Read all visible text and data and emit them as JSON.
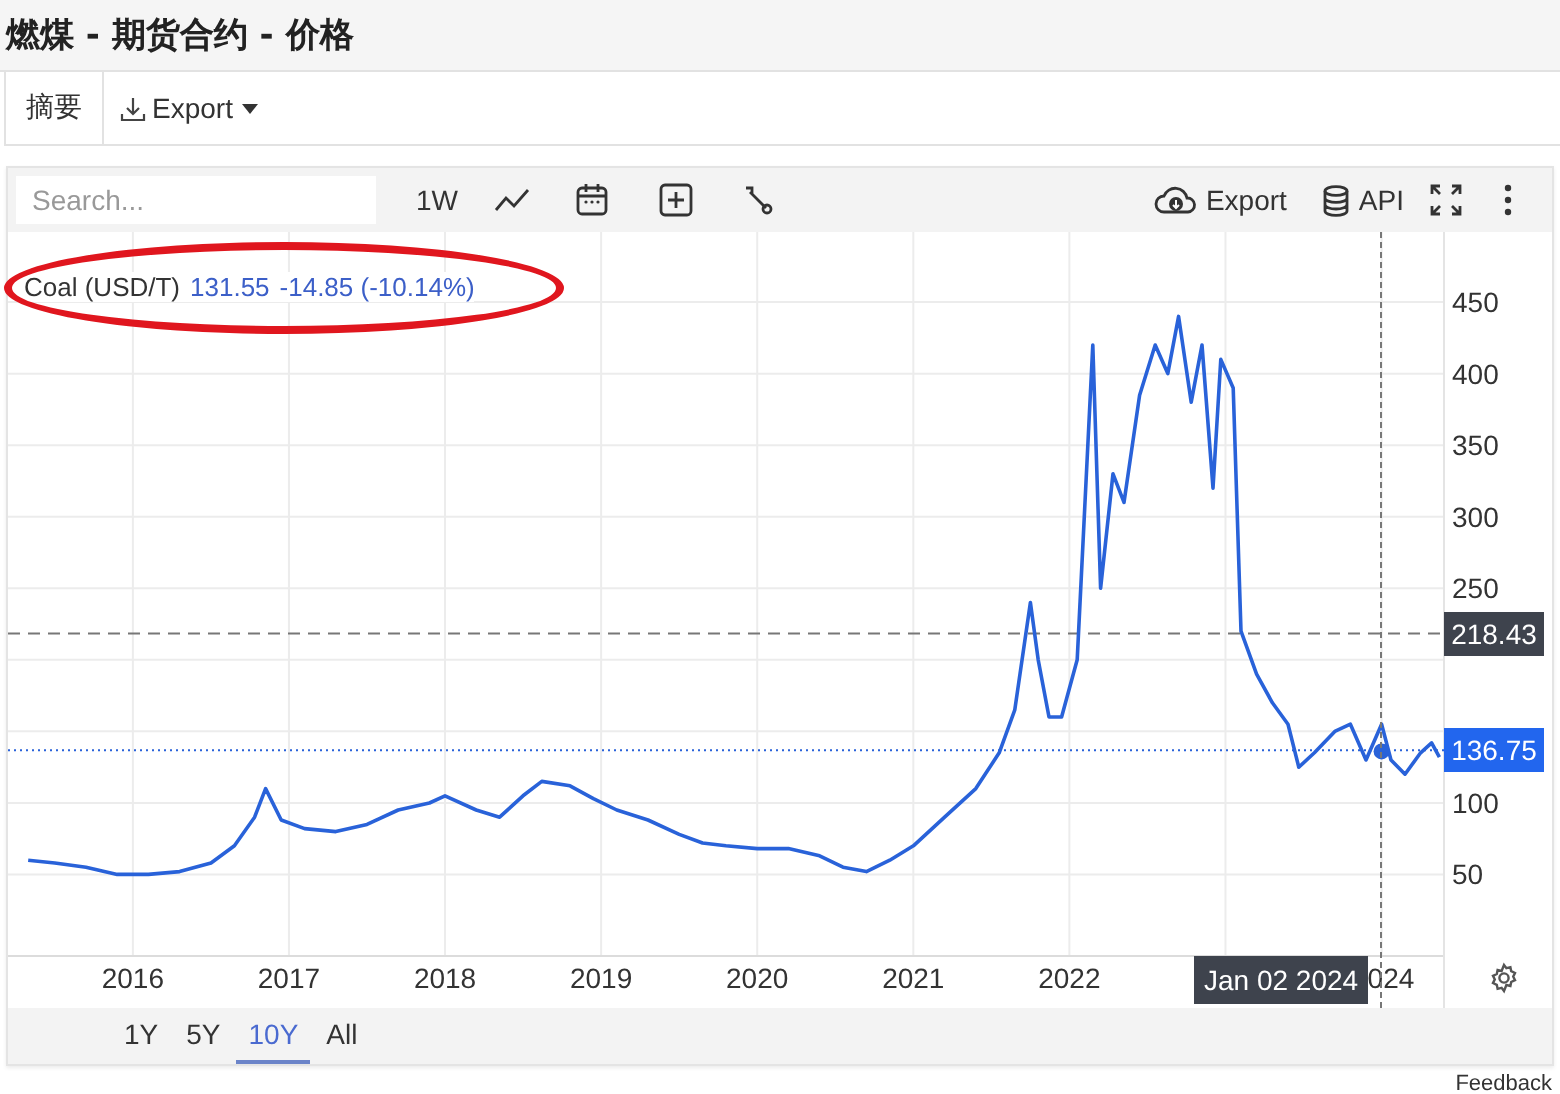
{
  "page_title": "燃煤 - 期货合约 - 价格",
  "tabs": [
    {
      "label": "摘要",
      "selected": true
    }
  ],
  "export_menu": {
    "label": "Export"
  },
  "toolbar": {
    "search": {
      "placeholder": "Search..."
    },
    "interval": "1W",
    "export": "Export",
    "api": "API"
  },
  "legend": {
    "price": "131.55",
    "change": "-14.85 (-10.14%)"
  },
  "chart": {
    "axis_fragment": "024",
    "chart_data": {
      "type": "line",
      "xlim": [
        2015.2,
        2024.4
      ],
      "ylim": [
        -7,
        499
      ],
      "grid": true,
      "xticks": [
        2016,
        2017,
        2018,
        2019,
        2020,
        2021,
        2022
      ],
      "yticks": [
        50,
        100,
        250,
        300,
        350,
        400,
        450
      ],
      "ref_lines": [
        {
          "axis": "y",
          "value": 136.75
        },
        {
          "axis": "y",
          "value": 218.43
        }
      ],
      "series": [
        {
          "name": "Coal (USD/T)",
          "color": "#2962d9",
          "x": [
            2015.33,
            2015.5,
            2015.7,
            2015.9,
            2016.1,
            2016.3,
            2016.5,
            2016.65,
            2016.78,
            2016.85,
            2016.95,
            2017.1,
            2017.3,
            2017.5,
            2017.7,
            2017.9,
            2018.0,
            2018.2,
            2018.35,
            2018.5,
            2018.62,
            2018.8,
            2018.95,
            2019.1,
            2019.3,
            2019.5,
            2019.65,
            2019.8,
            2020.0,
            2020.2,
            2020.4,
            2020.55,
            2020.7,
            2020.85,
            2021.0,
            2021.2,
            2021.4,
            2021.55,
            2021.65,
            2021.75,
            2021.8,
            2021.87,
            2021.95,
            2022.05,
            2022.15,
            2022.2,
            2022.28,
            2022.35,
            2022.45,
            2022.55,
            2022.63,
            2022.7,
            2022.78,
            2022.85,
            2022.92,
            2022.97,
            2023.05,
            2023.1,
            2023.2,
            2023.3,
            2023.4,
            2023.47,
            2023.57,
            2023.7,
            2023.8,
            2023.9,
            2024.0,
            2024.06,
            2024.15,
            2024.25,
            2024.32,
            2024.37
          ],
          "values": [
            60,
            58,
            55,
            50,
            50,
            52,
            58,
            70,
            90,
            110,
            88,
            82,
            80,
            85,
            95,
            100,
            105,
            95,
            90,
            105,
            115,
            112,
            103,
            95,
            88,
            78,
            72,
            70,
            68,
            68,
            63,
            55,
            52,
            60,
            70,
            90,
            110,
            135,
            165,
            240,
            200,
            160,
            160,
            200,
            420,
            250,
            330,
            310,
            385,
            420,
            400,
            440,
            380,
            420,
            320,
            410,
            390,
            220,
            190,
            170,
            155,
            125,
            135,
            150,
            155,
            130,
            155,
            130,
            120,
            135,
            142,
            132
          ]
        }
      ]
    }
  },
  "crosshair_value": "218.43",
  "last_price": "136.75",
  "crosshair_date": "Jan 02 2024",
  "ranges": [
    {
      "label": "1Y",
      "selected": false
    },
    {
      "label": "5Y",
      "selected": false
    },
    {
      "label": "10Y",
      "selected": true
    },
    {
      "label": "All",
      "selected": false
    }
  ],
  "feedback": "Feedback"
}
